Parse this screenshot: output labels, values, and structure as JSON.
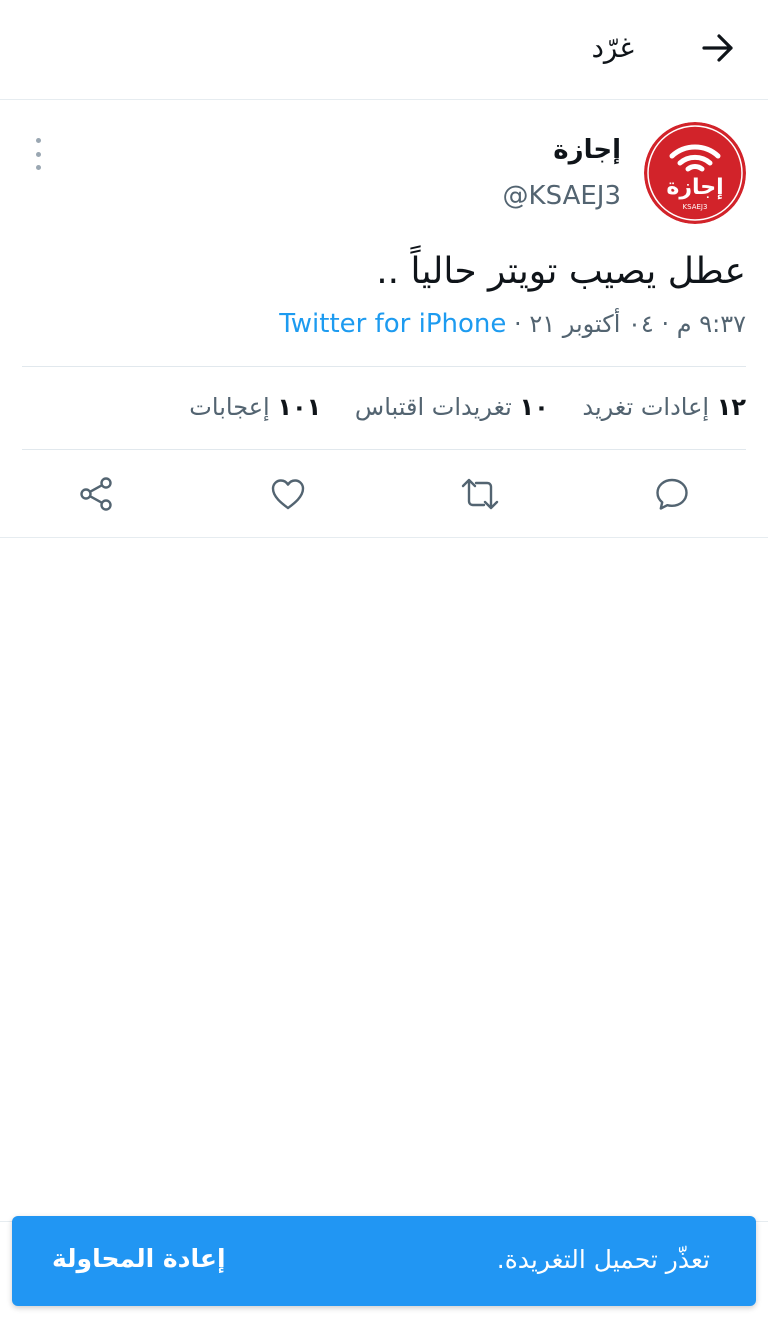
{
  "header": {
    "title": "غرّد",
    "back_icon": "arrow-right-icon"
  },
  "tweet": {
    "display_name": "إجازة",
    "handle": "@KSAEJ3",
    "avatar": {
      "text": "إجازة",
      "subtext": "KSAEJ3",
      "color": "#d2232a"
    },
    "text": "عطل يصيب تويتر حالياً ..",
    "time": "٩:٣٧ م",
    "date": "٠٤ أكتوبر ٢١",
    "separator": "·",
    "source": "Twitter for iPhone",
    "source_color": "#1d9bf0"
  },
  "stats": {
    "retweets_count": "١٢",
    "retweets_label": "إعادات تغريد",
    "quotes_count": "١٠",
    "quotes_label": "تغريدات اقتباس",
    "likes_count": "١٠١",
    "likes_label": "إعجابات"
  },
  "actions": {
    "reply_icon": "reply-icon",
    "retweet_icon": "retweet-icon",
    "like_icon": "heart-icon",
    "share_icon": "share-icon"
  },
  "snackbar": {
    "message": "تعذّر تحميل التغريدة.",
    "action": "إعادة المحاولة",
    "color": "#2196f3"
  }
}
